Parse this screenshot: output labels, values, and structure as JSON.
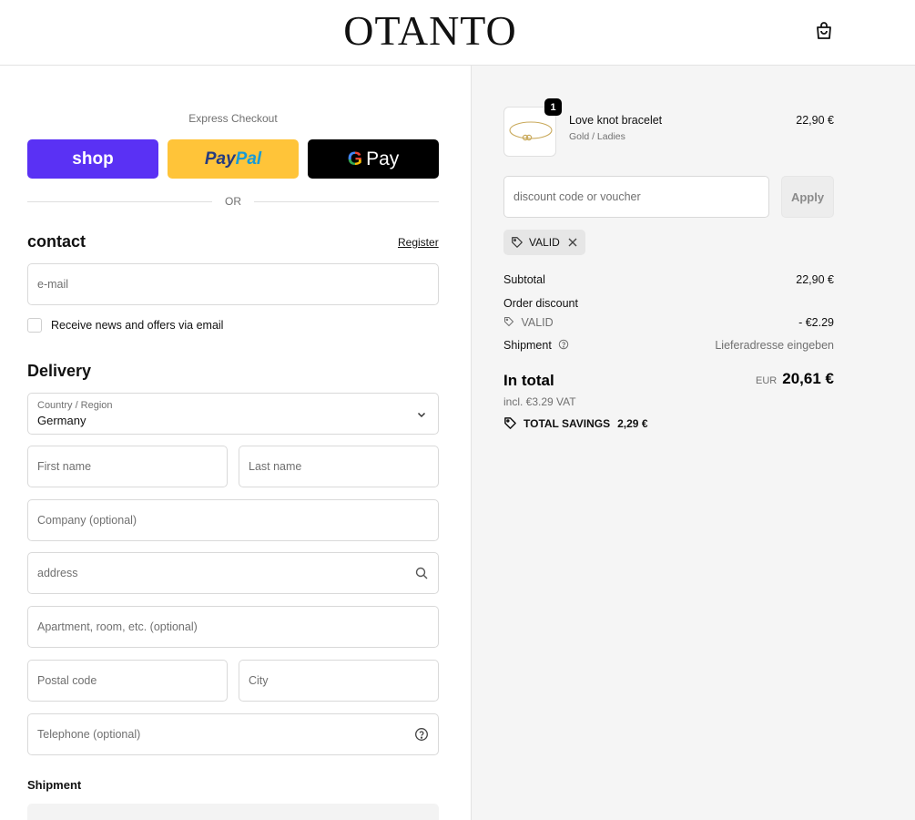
{
  "header": {
    "logo": "OTANTO",
    "cart_icon": "shopping-bag-icon"
  },
  "checkout": {
    "express_label": "Express Checkout",
    "shop_pay": "shop",
    "paypal_part1": "Pay",
    "paypal_part2": "Pal",
    "gpay_g": "G",
    "gpay_text": "Pay",
    "or": "OR",
    "contact_title": "contact",
    "register_link": "Register",
    "email_placeholder": "e-mail",
    "newsletter_label": "Receive news and offers via email",
    "delivery_title": "Delivery",
    "country_label": "Country / Region",
    "country_value": "Germany",
    "first_name": "First name",
    "last_name": "Last name",
    "company": "Company (optional)",
    "address": "address",
    "apartment": "Apartment, room, etc. (optional)",
    "postal_code": "Postal code",
    "city": "City",
    "telephone": "Telephone (optional)",
    "shipment_title": "Shipment"
  },
  "summary": {
    "quantity": "1",
    "product_name": "Love knot bracelet",
    "product_variant": "Gold / Ladies",
    "product_price": "22,90 €",
    "discount_placeholder": "discount code or voucher",
    "apply_label": "Apply",
    "applied_code": "VALID",
    "subtotal_label": "Subtotal",
    "subtotal_value": "22,90 €",
    "order_discount_label": "Order discount",
    "discount_code": "VALID",
    "discount_value": "- €2.29",
    "shipment_label": "Shipment",
    "shipment_value": "Lieferadresse eingeben",
    "total_label": "In total",
    "currency": "EUR",
    "total_value": "20,61 €",
    "vat": "incl. €3.29 VAT",
    "savings_label": "TOTAL SAVINGS",
    "savings_value": "2,29 €"
  },
  "colors": {
    "shop_pay": "#5a31f4",
    "paypal": "#ffc439",
    "gpay": "#000000",
    "summary_bg": "#f5f5f5"
  }
}
